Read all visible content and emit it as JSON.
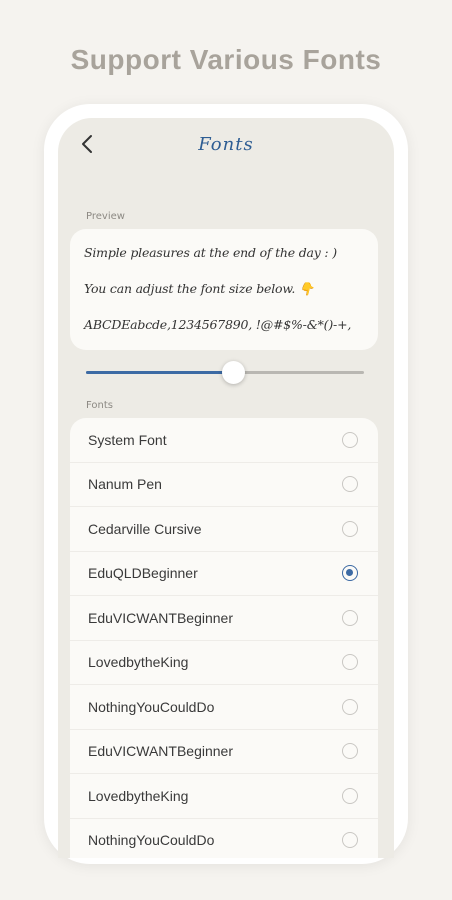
{
  "headline": "Support Various Fonts",
  "header": {
    "back_icon": "chevron-left-icon",
    "title": "Fonts"
  },
  "preview": {
    "label": "Preview",
    "lines": [
      "Simple pleasures at the end of the day : )",
      "You can adjust the font size below. 👇",
      "ABCDEabcde,1234567890, !@#$%-&*()-+,"
    ]
  },
  "font_size_slider": {
    "value_fraction": 0.53
  },
  "fonts": {
    "label": "Fonts",
    "items": [
      {
        "name": "System Font",
        "selected": false
      },
      {
        "name": "Nanum Pen",
        "selected": false
      },
      {
        "name": "Cedarville Cursive",
        "selected": false
      },
      {
        "name": "EduQLDBeginner",
        "selected": true
      },
      {
        "name": "EduVICWANTBeginner",
        "selected": false
      },
      {
        "name": "LovedbytheKing",
        "selected": false
      },
      {
        "name": "NothingYouCouldDo",
        "selected": false
      },
      {
        "name": "EduVICWANTBeginner",
        "selected": false
      },
      {
        "name": "LovedbytheKing",
        "selected": false
      },
      {
        "name": "NothingYouCouldDo",
        "selected": false
      }
    ]
  },
  "colors": {
    "accent": "#3c6aa4",
    "title": "#2e5d93",
    "background": "#f5f3ef"
  }
}
